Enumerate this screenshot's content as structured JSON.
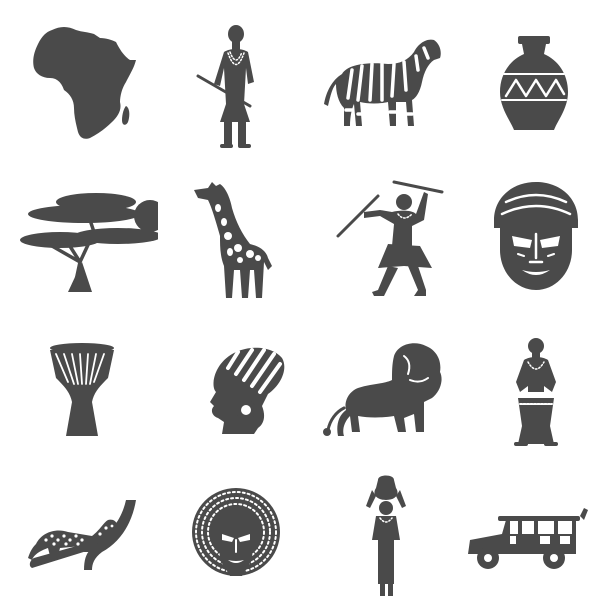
{
  "icon_set": {
    "theme": "Africa",
    "style": "monochrome glyph",
    "colors": {
      "icon": "#4a4a4a",
      "background": "#ffffff"
    },
    "rows": [
      [
        "africa-map-icon",
        "tribal-warrior-icon",
        "zebra-icon",
        "clay-vase-icon"
      ],
      [
        "acacia-tree-sun-icon",
        "giraffe-icon",
        "tribal-dancer-icon",
        "tribal-mask-icon"
      ],
      [
        "djembe-drum-icon",
        "woman-headwrap-icon",
        "lion-icon",
        "drummer-icon"
      ],
      [
        "leopard-on-branch-icon",
        "feathered-mask-icon",
        "woman-carrying-pot-icon",
        "safari-jeep-icon"
      ]
    ]
  }
}
